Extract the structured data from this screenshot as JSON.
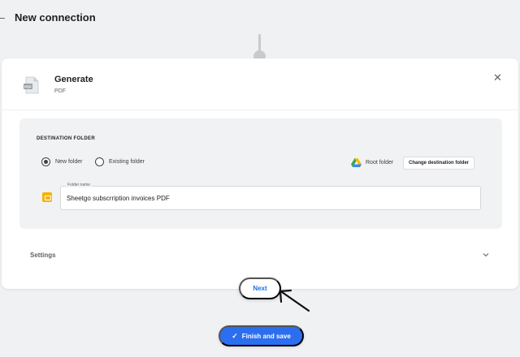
{
  "header": {
    "title": "New connection",
    "back_icon": "arrow-left-icon"
  },
  "step": {
    "title": "Generate",
    "subtitle": "PDF",
    "icon": "pdf-file-icon",
    "close_icon": "close-icon"
  },
  "destination": {
    "section_label": "DESTINATION FOLDER",
    "options": [
      {
        "label": "New folder",
        "selected": true
      },
      {
        "label": "Existing folder",
        "selected": false
      }
    ],
    "root_folder_label": "Root folder",
    "change_button_label": "Change destination folder",
    "folder_field": {
      "label": "Folder name",
      "value": "Sheetgo subscrription invoices PDF"
    }
  },
  "settings": {
    "label": "Settings",
    "expand_icon": "chevron-down-icon"
  },
  "actions": {
    "next_label": "Next",
    "finish_label": "Finish and save",
    "finish_icon": "check-icon"
  },
  "colors": {
    "accent": "#1a73e8",
    "finish_button": "#2b6ff0",
    "folder_icon": "#f4b400",
    "background": "#f0f1f3"
  }
}
